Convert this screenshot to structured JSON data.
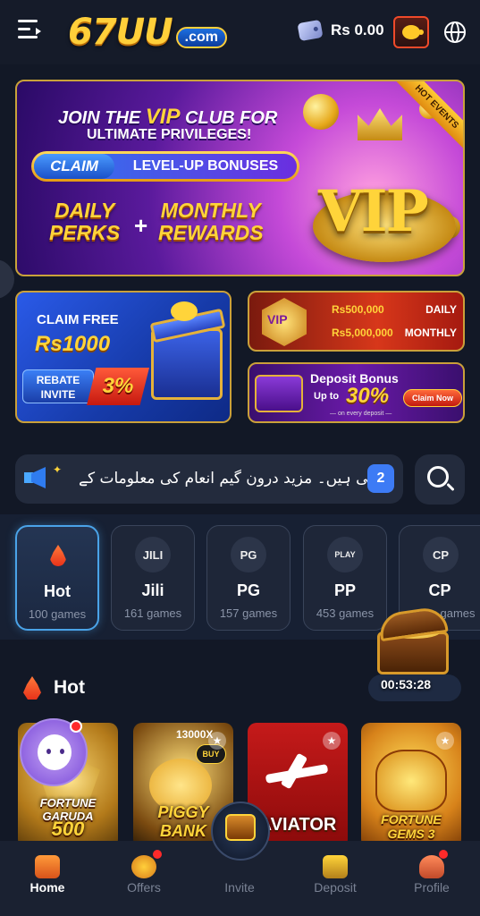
{
  "header": {
    "logo_main": "67UU",
    "logo_suffix": ".com",
    "balance": "Rs 0.00"
  },
  "banner_vip": {
    "line1_pre": "JOIN THE ",
    "line1_vip": "VIP",
    "line1_post": " CLUB FOR",
    "line2": "ULTIMATE PRIVILEGES!",
    "claim": "CLAIM",
    "claim_detail": "LEVEL-UP BONUSES",
    "perks_1": "DAILY",
    "perks_2": "PERKS",
    "plus": "+",
    "rewards_1": "MONTHLY",
    "rewards_2": "REWARDS",
    "emblem_text": "VIP",
    "ribbon": "HOT EVENTS"
  },
  "banner_free": {
    "line1": "CLAIM FREE",
    "amount": "Rs1000",
    "rebate_1": "REBATE",
    "rebate_2": "INVITE",
    "rebate_pct": "3%"
  },
  "banner_promo": {
    "badge": "VIP",
    "daily_amount": "Rs500,000",
    "daily_label": "DAILY",
    "monthly_amount": "Rs5,000,000",
    "monthly_label": "MONTHLY"
  },
  "banner_deposit": {
    "title": "Deposit Bonus",
    "upto": "Up to",
    "pct": "30%",
    "sub": "— on every deposit —",
    "claim": "Claim Now"
  },
  "marquee": {
    "text": "تی ہیں۔ مزید درون گیم انعام کی معلومات کے",
    "count": "2"
  },
  "categories": [
    {
      "name": "Hot",
      "count": "100 games",
      "icon": "flame-icon"
    },
    {
      "name": "Jili",
      "count": "161 games",
      "icon_text": "JILI"
    },
    {
      "name": "PG",
      "count": "157 games",
      "icon_text": "PG"
    },
    {
      "name": "PP",
      "count": "453 games",
      "icon_text": "PLAY"
    },
    {
      "name": "CP",
      "count": "games",
      "icon_text": "CP"
    }
  ],
  "timer": "00:53:28",
  "hot_section": {
    "title": "Hot"
  },
  "games": [
    {
      "name": "FORTUNE GARUDA",
      "sub": "500"
    },
    {
      "name": "PIGGY BANK",
      "multiplier": "13000X",
      "badge": "BUY"
    },
    {
      "name": "AVIATOR"
    },
    {
      "name": "FORTUNE GEMS 3"
    }
  ],
  "nav": {
    "home": "Home",
    "offers": "Offers",
    "invite": "Invite",
    "deposit": "Deposit",
    "profile": "Profile"
  }
}
